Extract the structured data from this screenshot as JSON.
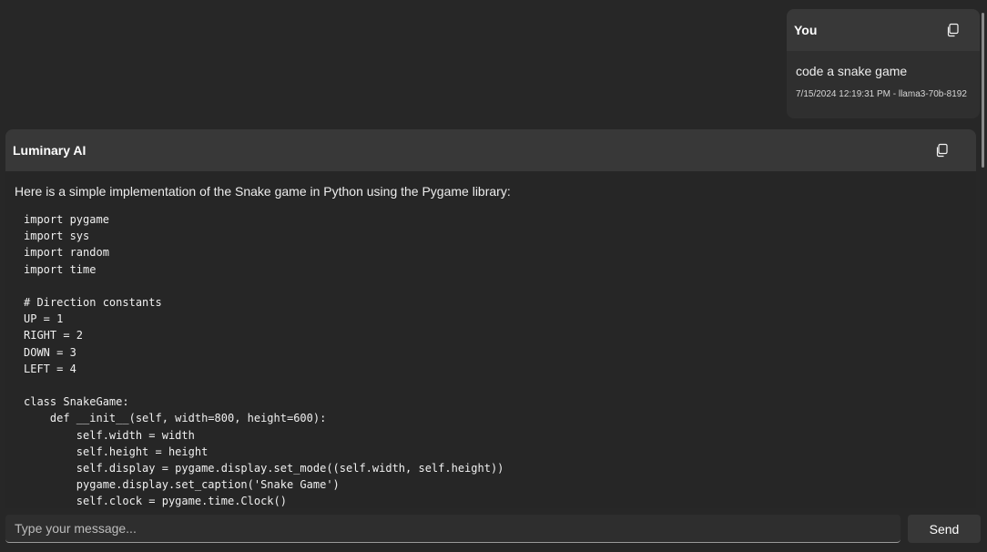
{
  "user_message": {
    "sender": "You",
    "text": "code a snake game",
    "meta": "7/15/2024 12:19:31 PM  -  llama3-70b-8192",
    "copy_icon": "copy-icon"
  },
  "ai_message": {
    "sender": "Luminary AI",
    "intro": "Here is a simple implementation of the Snake game in Python using the Pygame library:",
    "copy_icon": "copy-icon",
    "code_lines": [
      "import pygame",
      "import sys",
      "import random",
      "import time",
      "",
      "# Direction constants",
      "UP = 1",
      "RIGHT = 2",
      "DOWN = 3",
      "LEFT = 4",
      "",
      "class SnakeGame:",
      "    def __init__(self, width=800, height=600):",
      "        self.width = width",
      "        self.height = height",
      "        self.display = pygame.display.set_mode((self.width, self.height))",
      "        pygame.display.set_caption('Snake Game')",
      "        self.clock = pygame.time.Clock()"
    ]
  },
  "composer": {
    "placeholder": "Type your message...",
    "send_label": "Send"
  },
  "colors": {
    "background": "#272727",
    "card_header": "#383838",
    "input_background": "#2e2e2e",
    "send_button": "#373737"
  }
}
